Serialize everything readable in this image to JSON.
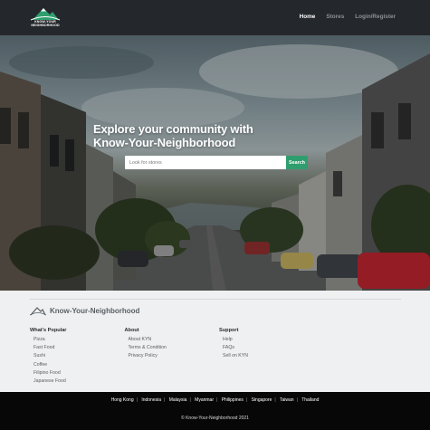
{
  "header": {
    "logo_text_line1": "KNOW-YOUR",
    "logo_text_line2": "NEIGHBORHOOD",
    "nav": [
      {
        "label": "Home",
        "active": true
      },
      {
        "label": "Stores",
        "active": false
      },
      {
        "label": "Login/Register",
        "active": false
      }
    ]
  },
  "hero": {
    "title_line1": "Explore your community with",
    "title_line2": "Know-Your-Neighborhood",
    "search_placeholder": "Look for stores",
    "search_button": "Search"
  },
  "footer": {
    "brand": "Know-Your-Neighborhood",
    "columns": [
      {
        "heading": "What's Popular",
        "items": [
          "Pizza",
          "Fast Food",
          "Sushi",
          "Coffee",
          "Filipino Food",
          "Japanese Food"
        ]
      },
      {
        "heading": "About",
        "items": [
          "About KYN",
          "Terms & Condition",
          "Privacy Policy"
        ]
      },
      {
        "heading": "Support",
        "items": [
          "Help",
          "FAQs",
          "Sell on KYN"
        ]
      }
    ],
    "countries": [
      "Hong Kong",
      "Indonesia",
      "Malaysia",
      "Myanmar",
      "Philippines",
      "Singapore",
      "Taiwan",
      "Thailand"
    ],
    "copyright": "© Know-Your-Neighborhood 2021"
  },
  "colors": {
    "header_bg": "#24272b",
    "accent_green": "#2f9e6e",
    "footer_bg": "#eef0f1",
    "bottom_bg": "#070707"
  },
  "icons": [
    "mountain-logo-icon",
    "mountain-brand-icon"
  ]
}
